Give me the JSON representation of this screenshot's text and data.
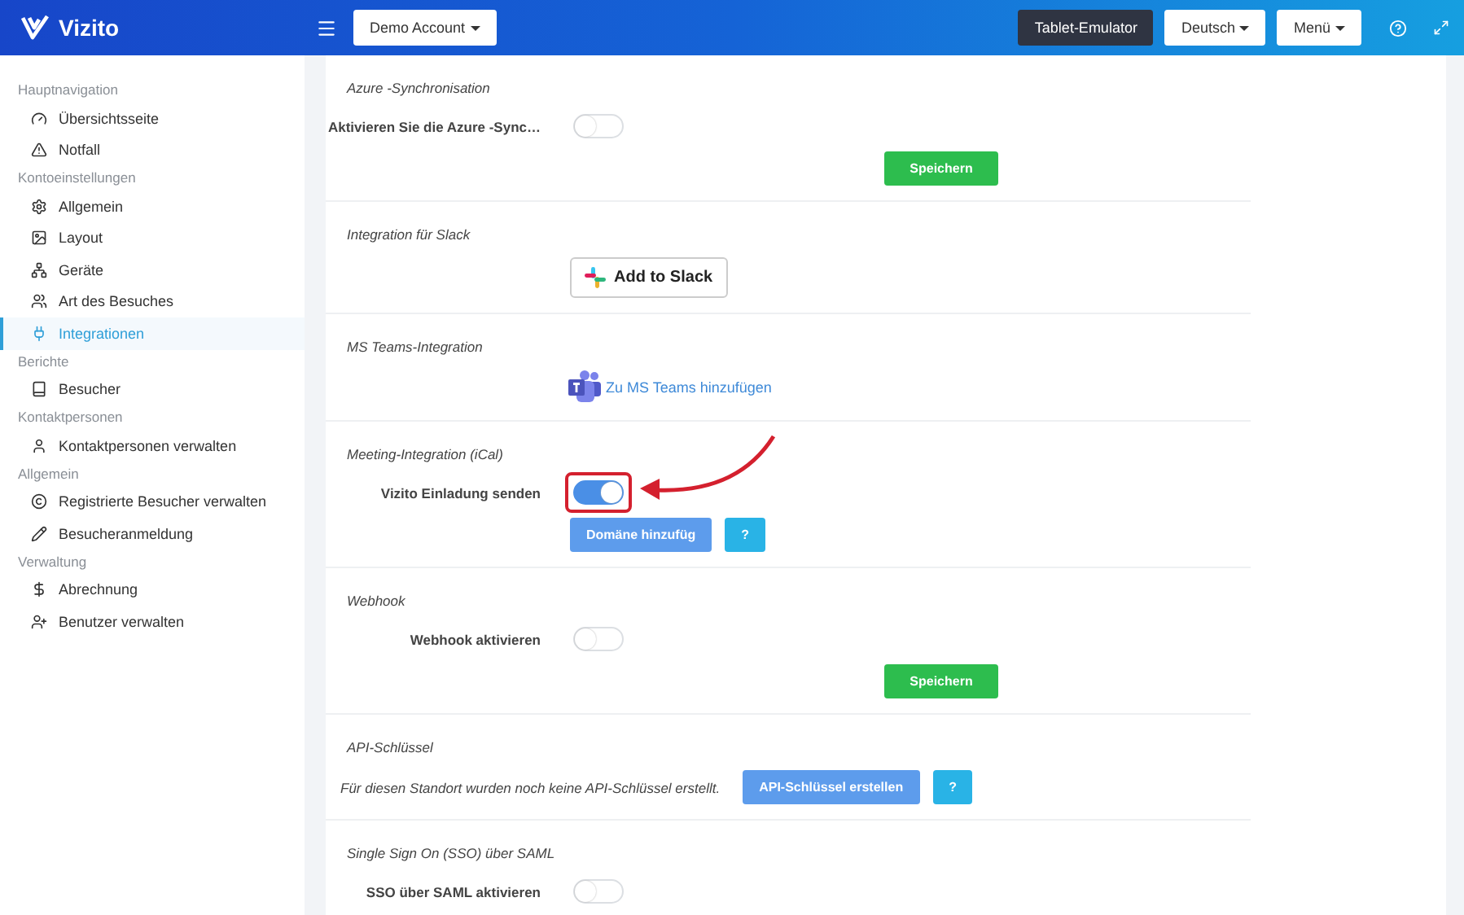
{
  "header": {
    "logo": "Vizito",
    "account": "Demo Account",
    "buttons": [
      {
        "label": "Tablet-Emulator",
        "kind": "dark"
      },
      {
        "label": "Deutsch",
        "kind": "dropdown"
      },
      {
        "label": "Menü",
        "kind": "dropdown"
      }
    ]
  },
  "sidebar": {
    "groups": [
      {
        "label": "Hauptnavigation",
        "items": [
          {
            "label": "Übersichtsseite",
            "selected": false
          },
          {
            "label": "Notfall",
            "selected": false
          }
        ]
      },
      {
        "label": "Kontoeinstellungen",
        "items": [
          {
            "label": "Allgemein",
            "selected": false
          },
          {
            "label": "Layout",
            "selected": false
          },
          {
            "label": "Geräte",
            "selected": false
          },
          {
            "label": "Art des Besuches",
            "selected": false
          },
          {
            "label": "Integrationen",
            "selected": true
          }
        ]
      },
      {
        "label": "Berichte",
        "items": [
          {
            "label": "Besucher",
            "selected": false
          }
        ]
      },
      {
        "label": "Kontaktpersonen",
        "items": [
          {
            "label": "Kontaktpersonen verwalten",
            "selected": false
          }
        ]
      },
      {
        "label": "Allgemein",
        "items": [
          {
            "label": "Registrierte Besucher verwalten",
            "selected": false
          },
          {
            "label": "Besucheranmeldung",
            "selected": false
          }
        ]
      },
      {
        "label": "Verwaltung",
        "items": [
          {
            "label": "Abrechnung",
            "selected": false
          },
          {
            "label": "Benutzer verwalten",
            "selected": false
          }
        ]
      }
    ]
  },
  "sections": [
    {
      "kind": "toggle",
      "title": "Azure -Synchronisation",
      "label": "Aktivieren Sie die Azure -Sync…",
      "on": false,
      "highlighted": false,
      "save": "Speichern"
    },
    {
      "kind": "slack",
      "title": "Integration für Slack",
      "button": "Add to Slack"
    },
    {
      "kind": "teams",
      "title": "MS Teams-Integration",
      "link": "Zu MS Teams hinzufügen"
    },
    {
      "kind": "toggle",
      "title": "Meeting-Integration (iCal)",
      "label": "Vizito Einladung senden",
      "on": true,
      "highlighted": true,
      "buttons": [
        {
          "label": "Domäne hinzufüg",
          "kind": "primary"
        },
        {
          "label": "?",
          "kind": "info"
        }
      ]
    },
    {
      "kind": "toggle",
      "title": "Webhook",
      "label": "Webhook aktivieren",
      "on": false,
      "highlighted": false,
      "save": "Speichern"
    },
    {
      "kind": "api",
      "title": "API-Schlüssel",
      "text": "Für diesen Standort wurden noch keine API-Schlüssel erstellt.",
      "buttons": [
        {
          "label": "API-Schlüssel erstellen",
          "kind": "primary"
        },
        {
          "label": "?",
          "kind": "info"
        }
      ]
    },
    {
      "kind": "toggle",
      "title": "Single Sign On (SSO) über SAML",
      "label": "SSO über SAML aktivieren",
      "on": false,
      "highlighted": false
    }
  ]
}
